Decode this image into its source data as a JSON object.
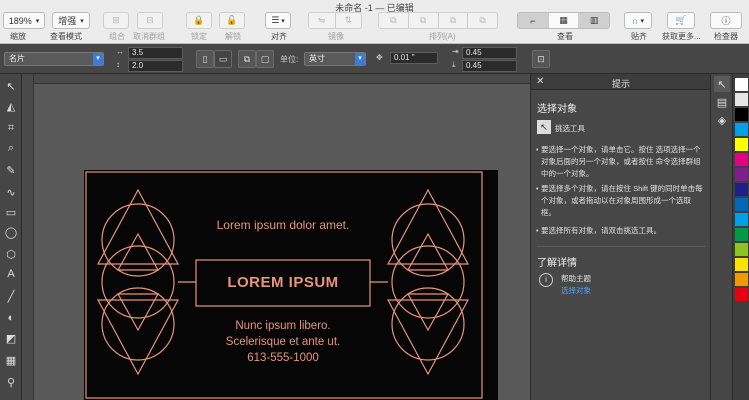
{
  "window": {
    "title": "未命名 -1 — 已编辑"
  },
  "toolbar": {
    "zoom_value": "189%",
    "zoom_label": "缩放",
    "view_mode_value": "增强",
    "view_mode_label": "查看模式",
    "group_label": "组合",
    "ungroup_label": "取消群组",
    "lock_label": "锁定",
    "unlock_label": "解锁",
    "align_label": "对齐",
    "mirror_label": "镜像",
    "arrange_label": "排列(A)",
    "view_label": "查看",
    "snap_label": "贴齐",
    "get_more_label": "获取更多...",
    "inspector_label": "检查器"
  },
  "propbar": {
    "object_type": "名片",
    "x": "3.5",
    "y": "2.0",
    "unit_label": "单位:",
    "unit_value": "英寸",
    "nudge": "0.01 \"",
    "dup_x": "0.45",
    "dup_y": "0.45"
  },
  "docker": {
    "title": "提示",
    "section_title": "选择对象",
    "tool_name": "挑选工具",
    "tips": [
      "要选择一个对象，请单击它。按住 选项选择一个对象后面的另一个对象，或者按住 命令选择群组中的一个对象。",
      "要选择多个对象，请在按住 Shift 键的同时单击每个对象，或者拖动以在对象周围形成一个选取框。",
      "要选择所有对象，请双击挑选工具。"
    ],
    "learn_more_title": "了解详情",
    "help_topic_label": "帮助主题",
    "help_topic_link": "选择对象"
  },
  "card": {
    "headline": "Lorem ipsum dolor amet.",
    "title": "LOREM IPSUM",
    "line1": "Nunc ipsum libero.",
    "line2": "Scelerisque et ante ut.",
    "phone": "613-555-1000"
  },
  "colors": {
    "card_accent": "#e8957a",
    "link": "#4ea2ff"
  },
  "palette": [
    "#ffffff",
    "#e6e6e6",
    "#000000",
    "#00a0e9",
    "#ffff00",
    "#e4007f",
    "#7c1f8c",
    "#1d2088",
    "#0068b7",
    "#00a0e9",
    "#009944",
    "#8fc31f",
    "#ffe100",
    "#f39800",
    "#e60012"
  ]
}
